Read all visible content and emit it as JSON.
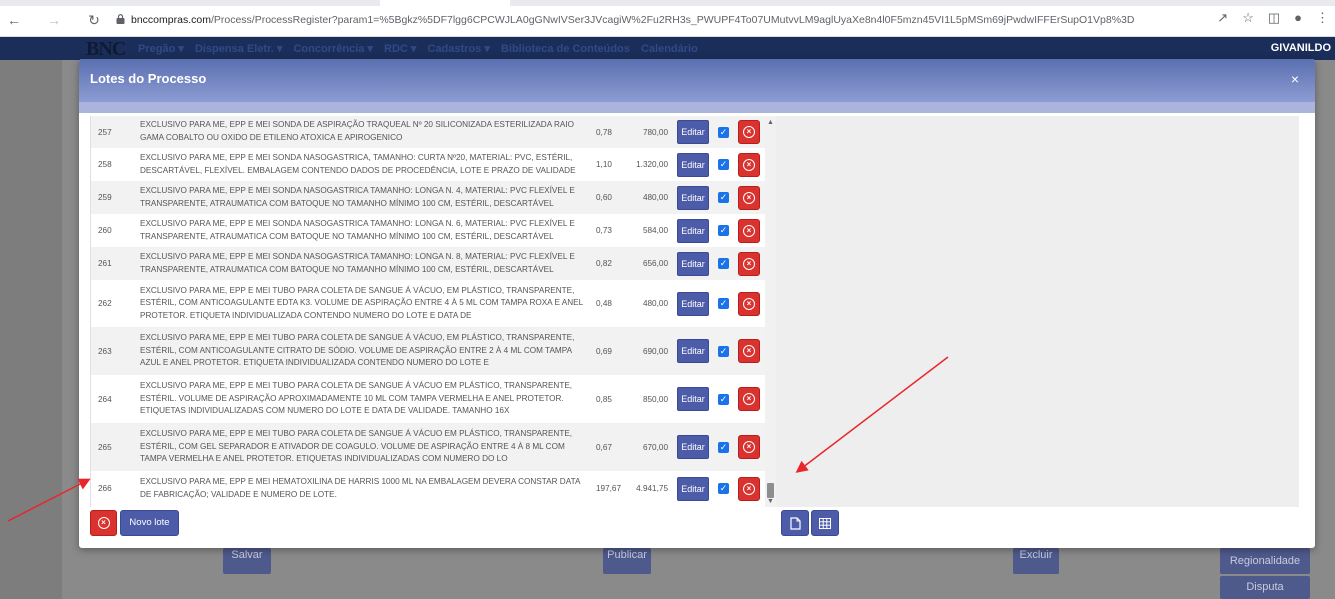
{
  "browser": {
    "url_host": "bnccompras.com",
    "url_path": "/Process/ProcessRegister?param1=%5Bgkz%5DF7lgg6CPCWJLA0gGNwIVSer3JVcagiW%2Fu2RH3s_PWUPF4To07UMutvvLM9aglUyaXe8n4l0F5mzn45VI1L5pMSm69jPwdwIFFErSupO1Vp8%3D"
  },
  "app": {
    "logo": "BNC",
    "menu": [
      "Pregão ▾",
      "Dispensa Eletr. ▾",
      "Concorrência ▾",
      "RDC ▾",
      "Cadastros ▾",
      "Biblioteca de Conteúdos",
      "Calendário"
    ],
    "user": "GIVANILDO",
    "bg_buttons": [
      "Salvar",
      "Publicar",
      "Excluir",
      "Regionalidade",
      "Disputa"
    ]
  },
  "modal": {
    "title": "Lotes do Processo",
    "close": "×",
    "edit_label": "Editar",
    "new_lot_label": "Novo lote",
    "rows": [
      {
        "num": "257",
        "desc": "EXCLUSIVO PARA ME, EPP E MEI SONDA DE ASPIRAÇÃO TRAQUEAL Nº 20 SILICONIZADA ESTERILIZADA RAIO GAMA COBALTO OU OXIDO DE ETILENO ATOXICA E APIROGENICO",
        "unit": "0,78",
        "total": "780,00"
      },
      {
        "num": "258",
        "desc": "EXCLUSIVO PARA ME, EPP E MEI SONDA NASOGASTRICA, TAMANHO: CURTA Nº20, MATERIAL: PVC, ESTÉRIL, DESCARTÁVEL, FLEXÍVEL. EMBALAGEM CONTENDO DADOS DE PROCEDÊNCIA, LOTE E PRAZO DE VALIDADE",
        "unit": "1,10",
        "total": "1.320,00"
      },
      {
        "num": "259",
        "desc": "EXCLUSIVO PARA ME, EPP E MEI SONDA NASOGASTRICA TAMANHO: LONGA N. 4, MATERIAL: PVC FLEXÍVEL E TRANSPARENTE, ATRAUMATICA COM BATOQUE NO TAMANHO MÍNIMO 100 CM, ESTÉRIL, DESCARTÁVEL",
        "unit": "0,60",
        "total": "480,00"
      },
      {
        "num": "260",
        "desc": "EXCLUSIVO PARA ME, EPP E MEI SONDA NASOGASTRICA TAMANHO: LONGA N. 6, MATERIAL: PVC FLEXÍVEL E TRANSPARENTE, ATRAUMATICA COM BATOQUE NO TAMANHO MÍNIMO 100 CM, ESTÉRIL, DESCARTÁVEL",
        "unit": "0,73",
        "total": "584,00"
      },
      {
        "num": "261",
        "desc": "EXCLUSIVO PARA ME, EPP E MEI SONDA NASOGASTRICA TAMANHO: LONGA N. 8, MATERIAL: PVC FLEXÍVEL E TRANSPARENTE, ATRAUMATICA COM BATOQUE NO TAMANHO MÍNIMO 100 CM, ESTÉRIL, DESCARTÁVEL",
        "unit": "0,82",
        "total": "656,00"
      },
      {
        "num": "262",
        "desc": "EXCLUSIVO PARA ME, EPP E MEI TUBO PARA COLETA DE SANGUE Á VÁCUO, EM PLÁSTICO, TRANSPARENTE, ESTÉRIL, COM ANTICOAGULANTE EDTA K3. VOLUME DE ASPIRAÇÃO ENTRE 4 À 5 ML COM TAMPA ROXA E ANEL PROTETOR. ETIQUETA INDIVIDUALIZADA CONTENDO NUMERO DO LOTE E DATA DE",
        "unit": "0,48",
        "total": "480,00"
      },
      {
        "num": "263",
        "desc": "EXCLUSIVO PARA ME, EPP E MEI TUBO PARA COLETA DE SANGUE Á VÁCUO, EM PLÁSTICO, TRANSPARENTE, ESTÉRIL, COM ANTICOAGULANTE CITRATO DE SÓDIO. VOLUME DE ASPIRAÇÃO ENTRE 2 À 4 ML COM TAMPA AZUL E ANEL PROTETOR. ETIQUETA INDIVIDUALIZADA CONTENDO NUMERO DO LOTE E",
        "unit": "0,69",
        "total": "690,00"
      },
      {
        "num": "264",
        "desc": "EXCLUSIVO PARA ME, EPP E MEI TUBO PARA COLETA DE SANGUE Á VÁCUO EM PLÁSTICO, TRANSPARENTE, ESTÉRIL. VOLUME DE ASPIRAÇÃO APROXIMADAMENTE 10 ML COM TAMPA VERMELHA E ANEL PROTETOR. ETIQUETAS INDIVIDUALIZADAS COM NUMERO DO LOTE E DATA DE VALIDADE. TAMANHO 16X",
        "unit": "0,85",
        "total": "850,00"
      },
      {
        "num": "265",
        "desc": "EXCLUSIVO PARA ME, EPP E MEI TUBO PARA COLETA DE SANGUE Á VÁCUO EM PLÁSTICO, TRANSPARENTE, ESTÉRIL, COM GEL SEPARADOR E ATIVADOR DE COAGULO. VOLUME DE ASPIRAÇÃO ENTRE 4 À 8 ML COM TAMPA VERMELHA E ANEL PROTETOR. ETIQUETAS INDIVIDUALIZADAS COM NUMERO DO LO",
        "unit": "0,67",
        "total": "670,00"
      },
      {
        "num": "266",
        "desc": "EXCLUSIVO PARA ME, EPP E MEI HEMATOXILINA DE HARRIS 1000 ML NA EMBALAGEM DEVERA CONSTAR DATA DE FABRICAÇÃO; VALIDADE E NUMERO DE LOTE.",
        "unit": "197,67",
        "total": "4.941,75"
      }
    ]
  },
  "colors": {
    "primary": "#4d5ca8",
    "danger": "#d9322f",
    "checkbox": "#1a73e8",
    "annotation_arrow": "#e8262b"
  }
}
